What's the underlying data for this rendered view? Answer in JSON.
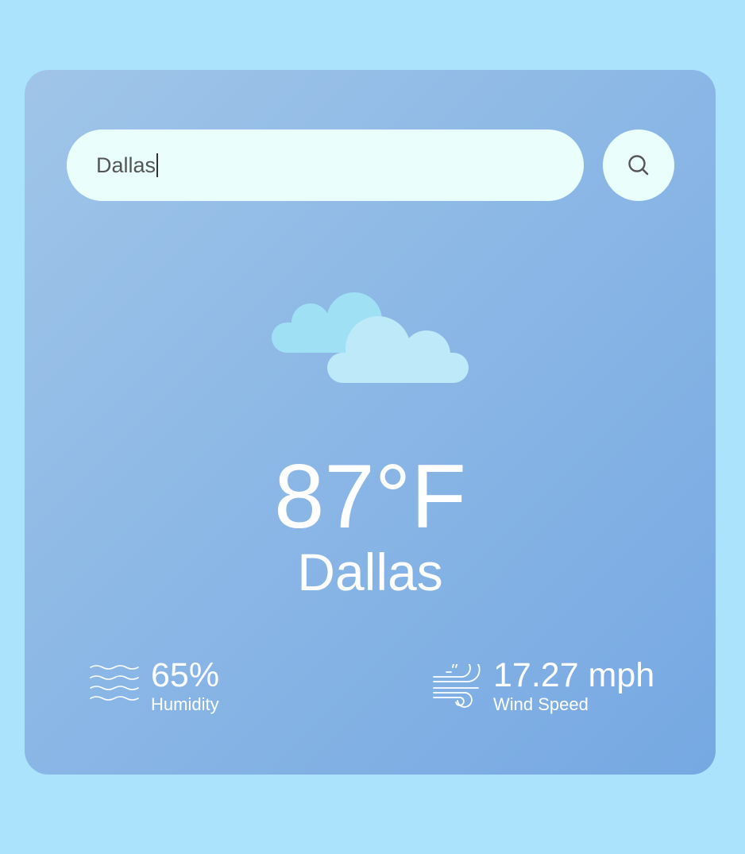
{
  "search": {
    "value": "Dallas",
    "icon": "search-icon"
  },
  "weather": {
    "icon": "clouds-icon",
    "temperature": "87°F",
    "city": "Dallas"
  },
  "stats": {
    "humidity": {
      "value": "65%",
      "label": "Humidity",
      "icon": "humidity-waves-icon"
    },
    "wind": {
      "value": "17.27 mph",
      "label": "Wind Speed",
      "icon": "wind-icon"
    }
  },
  "colors": {
    "page_background": "#abe3fd",
    "card_gradient_start": "#a0c5e8",
    "card_gradient_end": "#76a8e2",
    "input_background": "#eafffb",
    "text": "#ffffff"
  }
}
